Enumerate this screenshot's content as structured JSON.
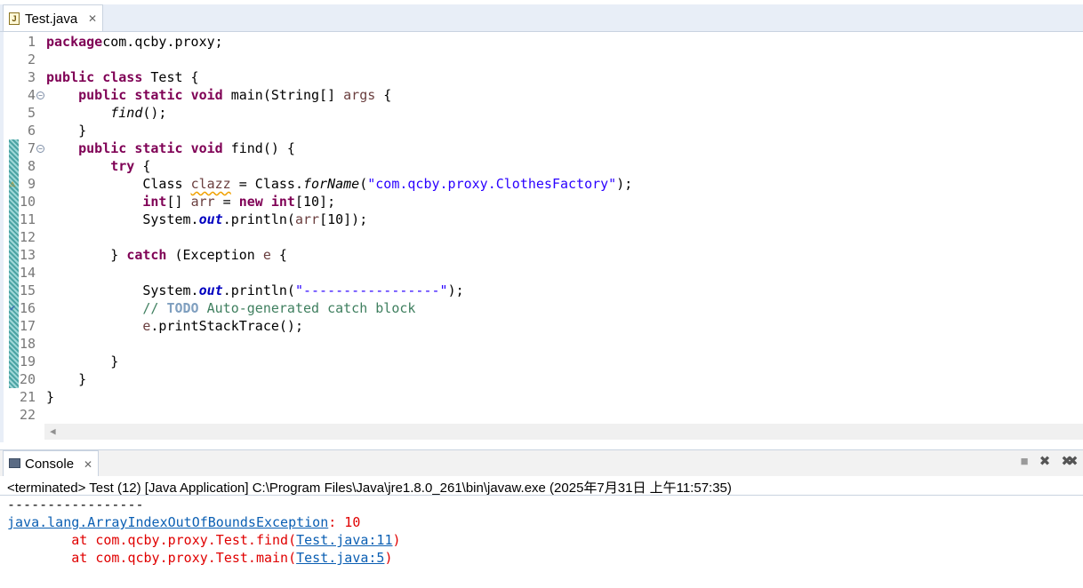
{
  "editor_tab": {
    "title": "Test.java",
    "close": "✕",
    "icon": "java-file-icon"
  },
  "code_lines": [
    {
      "n": "1",
      "tokens": [
        [
          "kw",
          "package"
        ],
        [
          "",
          "com.qcby.proxy;"
        ]
      ]
    },
    {
      "n": "2",
      "tokens": []
    },
    {
      "n": "3",
      "tokens": [
        [
          "kw",
          "public"
        ],
        [
          "",
          " "
        ],
        [
          "kw",
          "class"
        ],
        [
          "",
          " Test {"
        ]
      ]
    },
    {
      "n": "4",
      "fold": true,
      "tokens": [
        [
          "",
          "    "
        ],
        [
          "kw",
          "public"
        ],
        [
          "",
          " "
        ],
        [
          "kw",
          "static"
        ],
        [
          "",
          " "
        ],
        [
          "kw",
          "void"
        ],
        [
          "",
          " main(String[] "
        ],
        [
          "var",
          "args"
        ],
        [
          "",
          " {"
        ]
      ]
    },
    {
      "n": "5",
      "tokens": [
        [
          "",
          "        "
        ],
        [
          "it",
          "find"
        ],
        [
          "",
          "();"
        ]
      ]
    },
    {
      "n": "6",
      "tokens": [
        [
          "",
          "    }"
        ]
      ]
    },
    {
      "n": "7",
      "fold": true,
      "tokens": [
        [
          "",
          "    "
        ],
        [
          "kw",
          "public"
        ],
        [
          "",
          " "
        ],
        [
          "kw",
          "static"
        ],
        [
          "",
          " "
        ],
        [
          "kw",
          "void"
        ],
        [
          "",
          " find() {"
        ]
      ]
    },
    {
      "n": "8",
      "tokens": [
        [
          "",
          "        "
        ],
        [
          "kw",
          "try"
        ],
        [
          "",
          " {"
        ]
      ]
    },
    {
      "n": "9",
      "tokens": [
        [
          "",
          "            Class "
        ],
        [
          "var squig",
          "clazz"
        ],
        [
          "",
          " = Class."
        ],
        [
          "it",
          "forName"
        ],
        [
          "",
          "("
        ],
        [
          "str",
          "\"com.qcby.proxy.ClothesFactory\""
        ],
        [
          "",
          ");"
        ]
      ]
    },
    {
      "n": "10",
      "tokens": [
        [
          "",
          "            "
        ],
        [
          "kw",
          "int"
        ],
        [
          "",
          "[] "
        ],
        [
          "var",
          "arr"
        ],
        [
          "",
          " = "
        ],
        [
          "kw",
          "new"
        ],
        [
          "",
          " "
        ],
        [
          "kw",
          "int"
        ],
        [
          "",
          "[10];"
        ]
      ]
    },
    {
      "n": "11",
      "tokens": [
        [
          "",
          "            System."
        ],
        [
          "fld",
          "out"
        ],
        [
          "",
          ".println("
        ],
        [
          "var",
          "arr"
        ],
        [
          "",
          "[10]);"
        ]
      ]
    },
    {
      "n": "12",
      "tokens": []
    },
    {
      "n": "13",
      "tokens": [
        [
          "",
          "        } "
        ],
        [
          "kw",
          "catch"
        ],
        [
          "",
          " (Exception "
        ],
        [
          "var",
          "e"
        ],
        [
          "",
          " {"
        ]
      ]
    },
    {
      "n": "14",
      "tokens": []
    },
    {
      "n": "15",
      "tokens": [
        [
          "",
          "            System."
        ],
        [
          "fld",
          "out"
        ],
        [
          "",
          ".println("
        ],
        [
          "str",
          "\"-----------------\""
        ],
        [
          "",
          ");"
        ]
      ]
    },
    {
      "n": "16",
      "tokens": [
        [
          "",
          "            "
        ],
        [
          "cm",
          "// "
        ],
        [
          "todo",
          "TODO"
        ],
        [
          "cm",
          " Auto-generated catch block"
        ]
      ]
    },
    {
      "n": "17",
      "tokens": [
        [
          "",
          "            "
        ],
        [
          "var",
          "e"
        ],
        [
          "",
          ".printStackTrace();"
        ]
      ]
    },
    {
      "n": "18",
      "tokens": []
    },
    {
      "n": "19",
      "tokens": [
        [
          "",
          "        }"
        ]
      ]
    },
    {
      "n": "20",
      "tokens": [
        [
          "",
          "    }"
        ]
      ]
    },
    {
      "n": "21",
      "tokens": [
        [
          "",
          "}"
        ]
      ]
    },
    {
      "n": "22",
      "tokens": []
    }
  ],
  "console": {
    "tab_title": "Console",
    "close": "✕",
    "status": "<terminated> Test (12) [Java Application] C:\\Program Files\\Java\\jre1.8.0_261\\bin\\javaw.exe (2025年7月31日 上午11:57:35)",
    "toolbar": {
      "terminate": "■",
      "remove": "✖",
      "remove_all": "✖✖"
    },
    "output": {
      "dashes": "-----------------",
      "exception_class": "java.lang.ArrayIndexOutOfBoundsException",
      "exception_msg": ": 10",
      "trace": [
        {
          "prefix": "\tat com.qcby.proxy.Test.find(",
          "link": "Test.java:11",
          "suffix": ")"
        },
        {
          "prefix": "\tat com.qcby.proxy.Test.main(",
          "link": "Test.java:5",
          "suffix": ")"
        }
      ]
    }
  },
  "colors": {
    "keyword": "#7f0055",
    "string": "#2a00ff",
    "comment": "#3f7f5f",
    "error": "#e00000",
    "link": "#0b5fb3"
  }
}
